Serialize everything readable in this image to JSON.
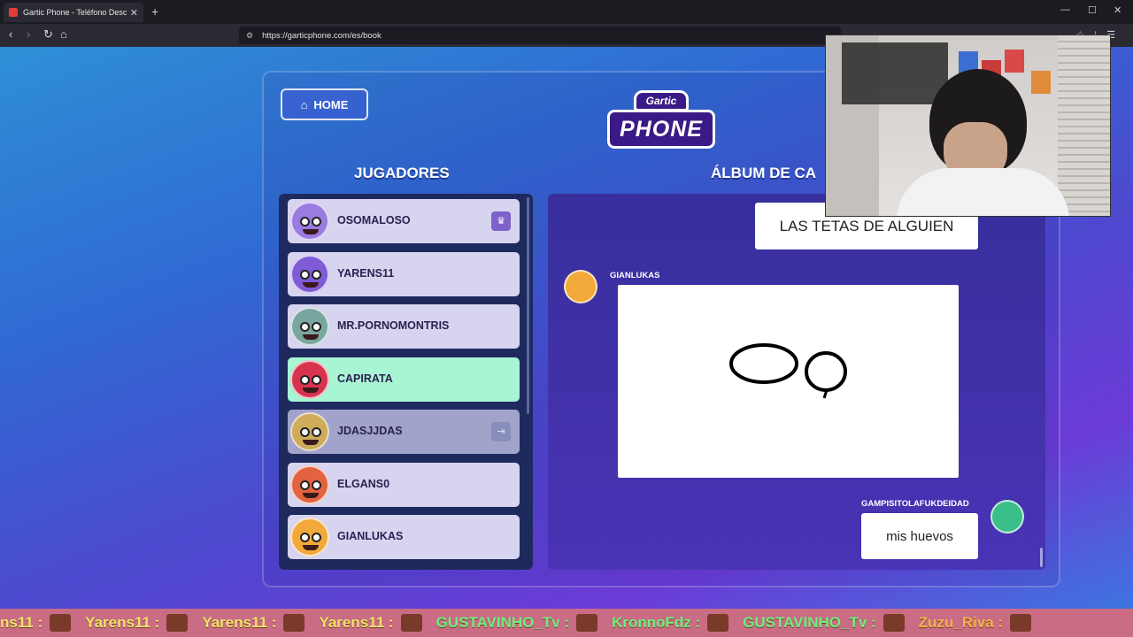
{
  "browser": {
    "tab_title": "Gartic Phone - Teléfono Descom",
    "url": "https://garticphone.com/es/book"
  },
  "page": {
    "home_label": "HOME",
    "logo_top": "Gartic",
    "logo_main": "PHONE",
    "players_title": "JUGADORES",
    "album_title": "ÁLBUM DE CA"
  },
  "players": [
    {
      "name": "OSOMALOSO",
      "badge": "crown-icon",
      "color": "#9a7be0"
    },
    {
      "name": "YARENS11",
      "color": "#7f5bd6"
    },
    {
      "name": "MR.PORNOMONTRIS",
      "color": "#7aa6a0"
    },
    {
      "name": "CAPIRATA",
      "color": "#d8334e"
    },
    {
      "name": "JDASJJDAS",
      "badge": "exit-icon",
      "color": "#d8b35a"
    },
    {
      "name": "ELGANS0",
      "color": "#e3623f"
    },
    {
      "name": "GIANLUKAS",
      "color": "#f2a93a"
    }
  ],
  "album": {
    "first_text": "LAS TETAS DE ALGUIEN",
    "drawing_author": "GIANLUKAS",
    "answer_author": "GAMPISITOLAFUKDEIDAD",
    "answer_text": "mis huevos"
  },
  "ticker": {
    "items": [
      "ns11 :",
      "Yarens11 :",
      "Yarens11 :",
      "Yarens11 :",
      "GUSTAVINHO_Tv :",
      "KronnoFdz :",
      "GUSTAVINHO_Tv :",
      "Zuzu_Riva :"
    ]
  }
}
